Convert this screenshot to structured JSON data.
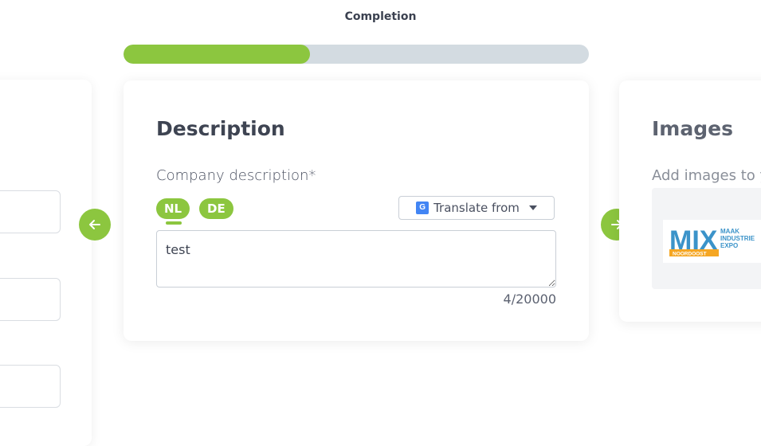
{
  "completion": {
    "title": "Completion",
    "progress_fraction": 0.4
  },
  "description_card": {
    "title": "Description",
    "field_label": "Company description*",
    "languages": [
      "NL",
      "DE"
    ],
    "active_language": "NL",
    "translate_label": "Translate from",
    "textarea_value": "test",
    "char_count": "4/20000"
  },
  "images_card": {
    "title": "Images",
    "subtitle": "Add images to y"
  },
  "logo": {
    "word": "MIX",
    "line1": "MAAK",
    "line2": "INDUSTRIE",
    "line3": "EXPO",
    "badge": "NOORDOOST"
  },
  "icons": {
    "prev": "arrow-left-icon",
    "next": "arrow-right-icon",
    "translate": "google-translate-icon",
    "caret": "caret-down-icon"
  },
  "colors": {
    "accent": "#8cc63f",
    "track": "#d3dbe1",
    "logo_blue": "#3b93c9",
    "logo_orange": "#f5a623"
  }
}
